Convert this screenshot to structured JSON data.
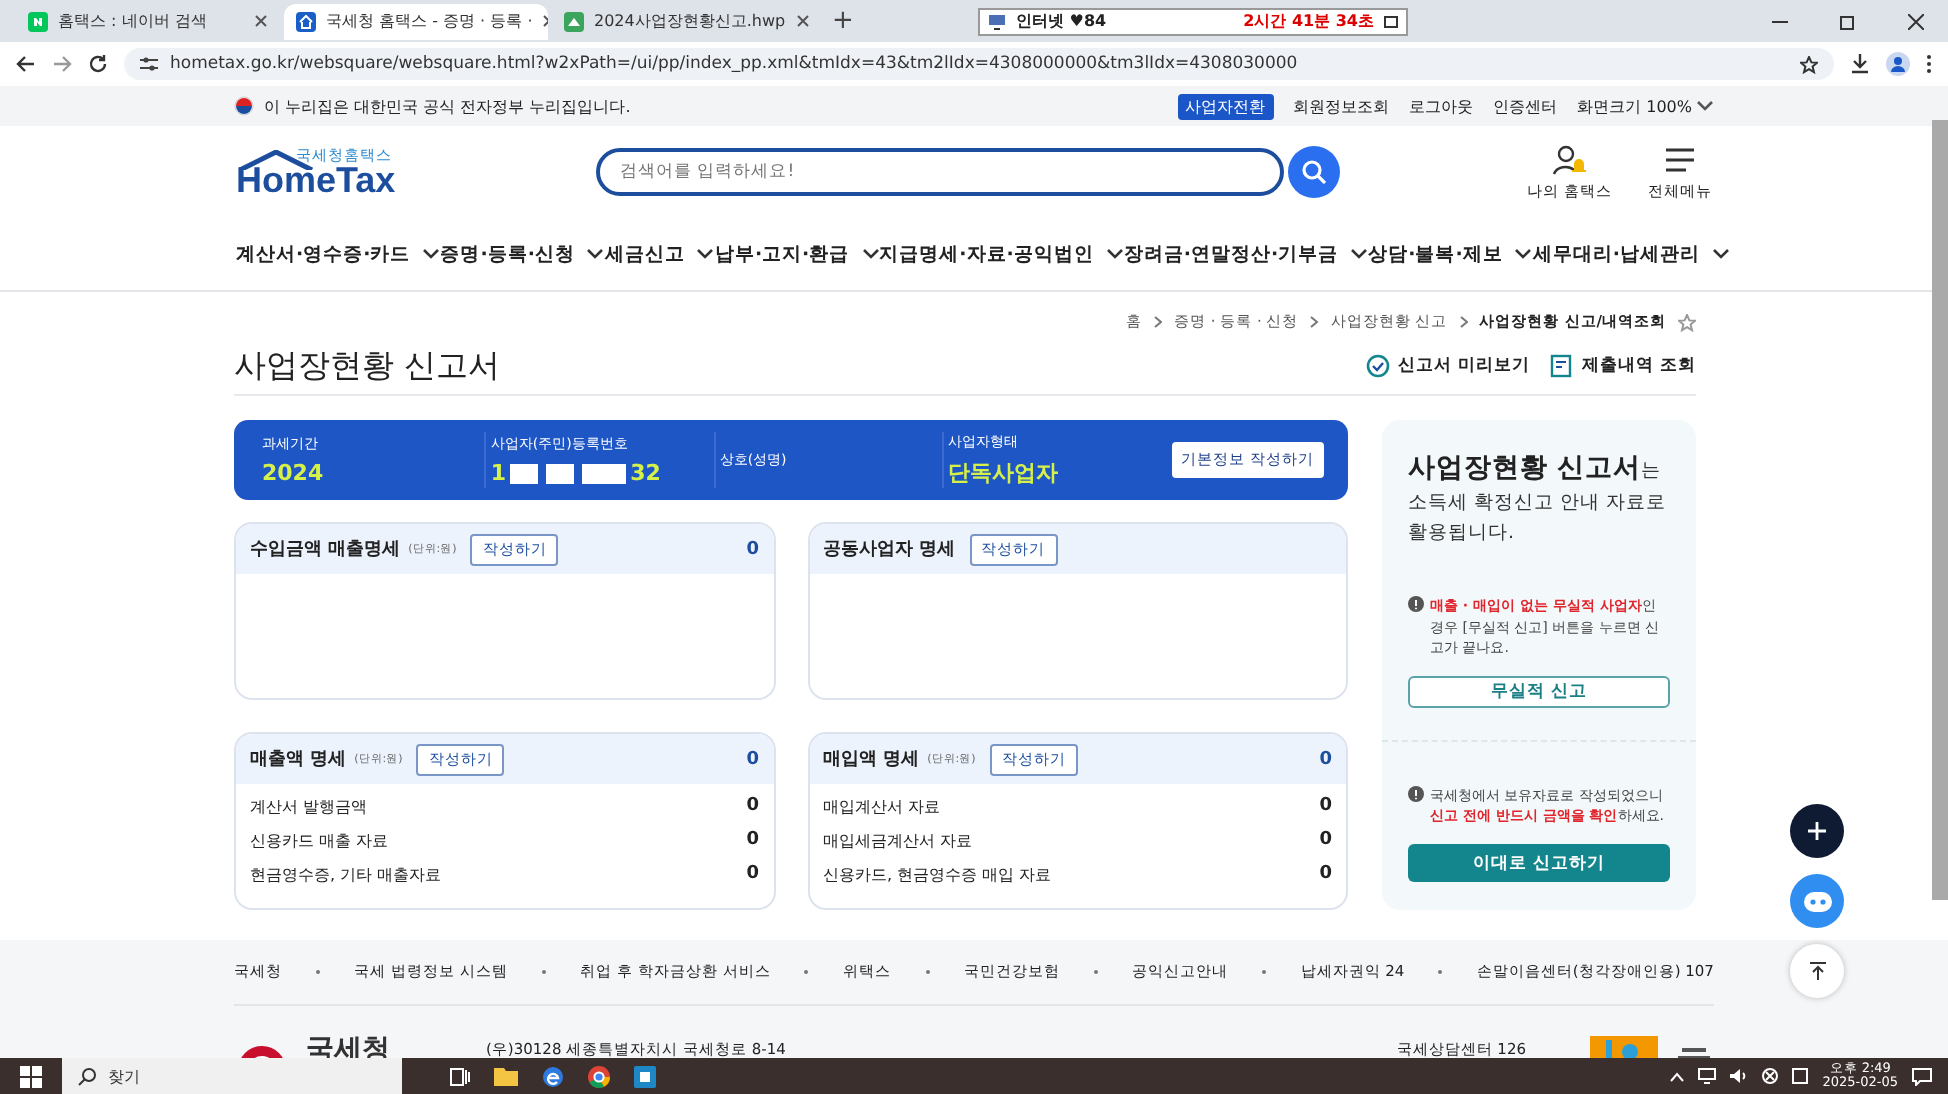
{
  "browser": {
    "tabs": [
      {
        "title": "홈택스 : 네이버 검색",
        "kind": "naver",
        "selected": false
      },
      {
        "title": "국세청 홈택스 - 증명 · 등록 ·",
        "kind": "hometax",
        "selected": true
      },
      {
        "title": "2024사업장현황신고.hwp",
        "kind": "hwp",
        "selected": false
      }
    ],
    "new_tab": "+",
    "timer": {
      "label": "인터넷 ♥84",
      "time": "2시간 41분 34초"
    },
    "url": "hometax.go.kr/websquare/websquare.html?w2xPath=/ui/pp/index_pp.xml&tmIdx=43&tm2lIdx=4308000000&tm3lIdx=4308030000"
  },
  "gov_bar": {
    "notice": "이 누리집은 대한민국 공식 전자정부 누리집입니다.",
    "links": [
      {
        "label": "사업자전환",
        "kind": "badge"
      },
      {
        "label": "회원정보조회",
        "kind": "link"
      },
      {
        "label": "로그아웃",
        "kind": "link"
      },
      {
        "label": "인증센터",
        "kind": "link"
      },
      {
        "label": "화면크기 100%",
        "kind": "dropdown"
      }
    ]
  },
  "header": {
    "logo_small": "국세청홈택스",
    "logo": "HomeTax",
    "search": {
      "placeholder": "검색어를 입력하세요!"
    },
    "actions": [
      {
        "label": "나의 홈택스",
        "kind": "user"
      },
      {
        "label": "전체메뉴",
        "kind": "menu"
      }
    ]
  },
  "nav": [
    "계산서·영수증·카드",
    "증명·등록·신청",
    "세금신고",
    "납부·고지·환급",
    "지급명세·자료·공익법인",
    "장려금·연말정산·기부금",
    "상담·불복·제보",
    "세무대리·납세관리"
  ],
  "breadcrumb": [
    "홈",
    "증명 · 등록 · 신청",
    "사업장현황 신고",
    "사업장현황 신고/내역조회"
  ],
  "page": {
    "title": "사업장현황 신고서",
    "actions": [
      {
        "label": "신고서 미리보기",
        "kind": "preview"
      },
      {
        "label": "제출내역 조회",
        "kind": "history"
      }
    ]
  },
  "info_bar": {
    "fields": [
      {
        "label": "과세기간",
        "value": "2024",
        "kind": "plain"
      },
      {
        "label": "사업자(주민)등록번호",
        "value_start": "1",
        "value_end": "32",
        "kind": "masked"
      },
      {
        "label": "상호(성명)",
        "kind": "empty"
      },
      {
        "label": "사업자형태",
        "value": "단독사업자",
        "kind": "plain"
      }
    ],
    "button": "기본정보 작성하기"
  },
  "cards": [
    {
      "title": "수입금액 매출명세",
      "unit": "(단위:원)",
      "button": "작성하기",
      "total": "0"
    },
    {
      "title": "공동사업자 명세",
      "button": "작성하기"
    },
    {
      "title": "매출액 명세",
      "unit": "(단위:원)",
      "button": "작성하기",
      "total": "0",
      "rows": [
        {
          "label": "계산서 발행금액",
          "value": "0"
        },
        {
          "label": "신용카드 매출 자료",
          "value": "0"
        },
        {
          "label": "현금영수증, 기타 매출자료",
          "value": "0"
        }
      ]
    },
    {
      "title": "매입액 명세",
      "unit": "(단위:원)",
      "button": "작성하기",
      "total": "0",
      "rows": [
        {
          "label": "매입계산서 자료",
          "value": "0"
        },
        {
          "label": "매입세금계산서 자료",
          "value": "0"
        },
        {
          "label": "신용카드, 현금영수증 매입 자료",
          "value": "0"
        }
      ]
    }
  ],
  "side_panel": {
    "heading": "**사업장현황 신고서**는 소득세 확정신고 안내 자료로 활용됩니다.",
    "note1": "**매출 · 매입이 없는 무실적 사업자**인 경우 [무실적 신고] 버튼을 누르면 신고가 끝나요.",
    "button1": "무실적 신고",
    "note2": "국세청에서 보유자료로 작성되었으니 **신고 전에 반드시 금액을 확인**하세요.",
    "button2": "이대로 신고하기"
  },
  "footer": {
    "links": [
      "국세청",
      "국세 법령정보 시스템",
      "취업 후 학자금상환 서비스",
      "위택스",
      "국민건강보험",
      "공익신고안내",
      "납세자권익 24",
      "손말이음센터(청각장애인용) 107"
    ],
    "logo": "국세청",
    "address": "(우)30128 세종특별자치시 국세청로 8-14",
    "contact": "국세상담센터 126"
  },
  "taskbar": {
    "search": "찾기",
    "time": "오후 2:49",
    "date": "2025-02-05"
  }
}
